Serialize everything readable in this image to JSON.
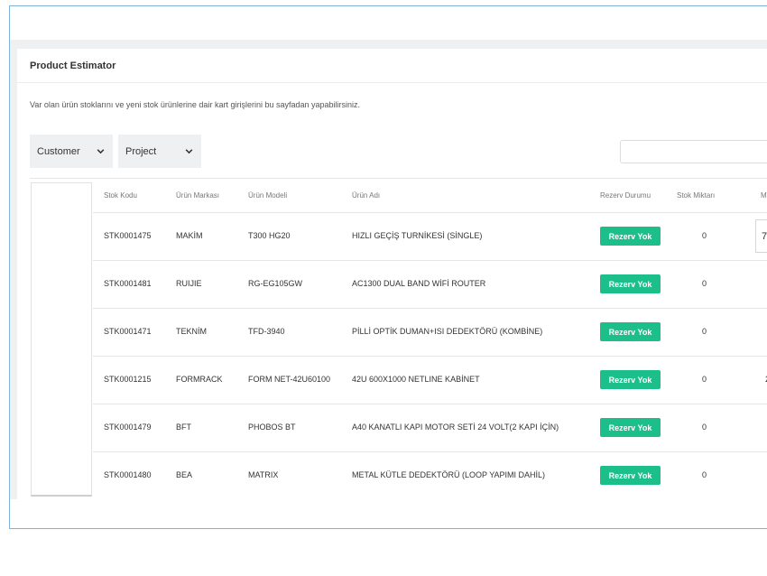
{
  "card": {
    "title": "Product Estimator",
    "description": "Var olan ürün stoklarını ve yeni stok ürünlerine dair kart girişlerini bu sayfadan yapabilirsiniz."
  },
  "filters": {
    "customer": "Customer",
    "project": "Project"
  },
  "table": {
    "headers": [
      "Stok Kodu",
      "Ürün Markası",
      "Ürün Modeli",
      "Ürün Adı",
      "Rezerv Durumu",
      "Stok Miktarı",
      "M"
    ],
    "rows": [
      {
        "code": "STK0001475",
        "brand": "MAKİM",
        "model": "T300 HG20",
        "name": "HIZLI GEÇİŞ TURNİKESİ (SİNGLE)",
        "status": "Rezerv Yok",
        "stock": "0",
        "extra": "7"
      },
      {
        "code": "STK0001481",
        "brand": "RUIJIE",
        "model": "RG-EG105GW",
        "name": "AC1300 DUAL BAND WİFİ ROUTER",
        "status": "Rezerv Yok",
        "stock": "0",
        "extra": ""
      },
      {
        "code": "STK0001471",
        "brand": "TEKNİM",
        "model": "TFD-3940",
        "name": "PİLLİ OPTİK DUMAN+ISI DEDEKTÖRÜ (KOMBİNE)",
        "status": "Rezerv Yok",
        "stock": "0",
        "extra": ""
      },
      {
        "code": "STK0001215",
        "brand": "FORMRACK",
        "model": "FORM NET-42U60100",
        "name": "42U 600X1000 NETLINE KABİNET",
        "status": "Rezerv Yok",
        "stock": "0",
        "extra": "2"
      },
      {
        "code": "STK0001479",
        "brand": "BFT",
        "model": "PHOBOS BT",
        "name": "A40 KANATLI KAPI MOTOR SETİ 24 VOLT(2 KAPI İÇİN)",
        "status": "Rezerv Yok",
        "stock": "0",
        "extra": ""
      },
      {
        "code": "STK0001480",
        "brand": "BEA",
        "model": "MATRIX",
        "name": "METAL KÜTLE DEDEKTÖRÜ (LOOP YAPIMI DAHİL)",
        "status": "Rezerv Yok",
        "stock": "0",
        "extra": ""
      }
    ]
  },
  "colors": {
    "badge": "#1cbf8a",
    "frame_border": "#7fb3dd"
  },
  "icons": {
    "dropdown": "chevron-down-icon"
  }
}
